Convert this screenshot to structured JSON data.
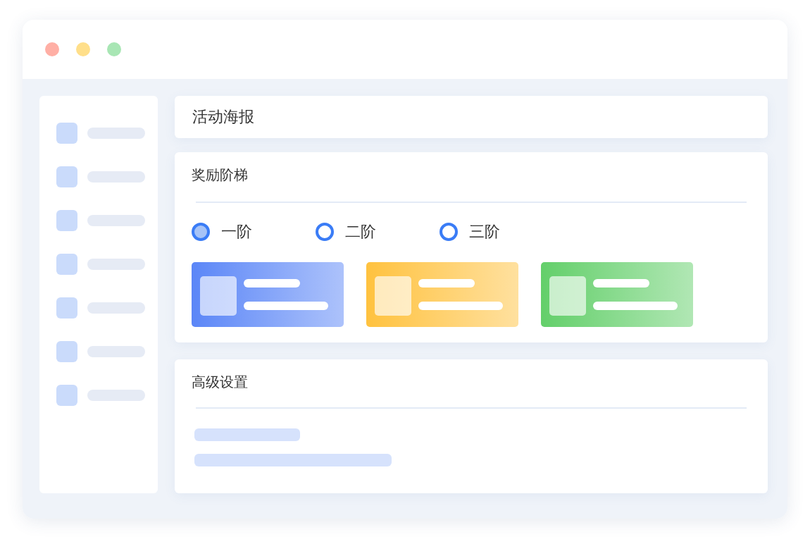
{
  "poster": {
    "title": "活动海报"
  },
  "reward": {
    "title": "奖励阶梯",
    "tiers": [
      {
        "label": "一阶",
        "selected": true
      },
      {
        "label": "二阶",
        "selected": false
      },
      {
        "label": "三阶",
        "selected": false
      }
    ],
    "cards": [
      {
        "color": "#5b86f7"
      },
      {
        "color": "#ffc23f"
      },
      {
        "color": "#63cf6a"
      }
    ]
  },
  "advanced": {
    "title": "高级设置"
  }
}
